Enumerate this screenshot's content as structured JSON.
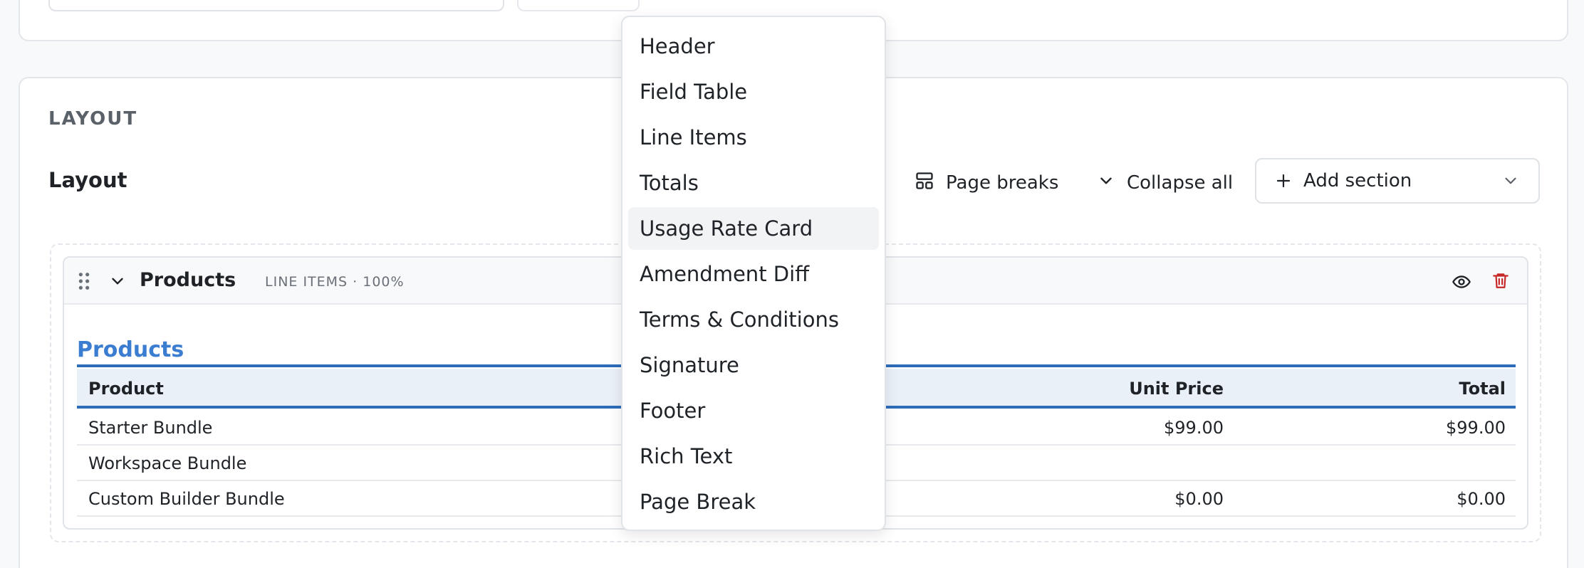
{
  "layout_card": {
    "section_caption": "LAYOUT",
    "heading": "Layout",
    "toolbar": {
      "page_breaks_label": "Page breaks",
      "collapse_all_label": "Collapse all",
      "add_section_label": "Add section"
    }
  },
  "section": {
    "title": "Products",
    "meta": "LINE ITEMS · 100%",
    "preview": {
      "title": "Products",
      "columns": {
        "product": "Product",
        "unit_price": "Unit Price",
        "total": "Total"
      },
      "rows": [
        {
          "product": "Starter Bundle",
          "unit_price": "$99.00",
          "total": "$99.00"
        },
        {
          "product": "Workspace Bundle",
          "unit_price": "",
          "total": ""
        },
        {
          "product": "Custom Builder Bundle",
          "unit_price": "$0.00",
          "total": "$0.00"
        }
      ]
    }
  },
  "add_section_menu": {
    "items": [
      "Header",
      "Field Table",
      "Line Items",
      "Totals",
      "Usage Rate Card",
      "Amendment Diff",
      "Terms & Conditions",
      "Signature",
      "Footer",
      "Rich Text",
      "Page Break"
    ],
    "highlighted": "Usage Rate Card"
  },
  "colors": {
    "accent_blue": "#2d6cb8",
    "preview_title_blue": "#3b7dd1",
    "delete_red": "#c62828"
  },
  "icons": {
    "page_breaks": "page-breaks-icon",
    "collapse": "chevron-down-icon",
    "add": "plus-icon",
    "drag": "drag-handle-icon",
    "visibility": "eye-icon",
    "delete": "trash-icon"
  }
}
